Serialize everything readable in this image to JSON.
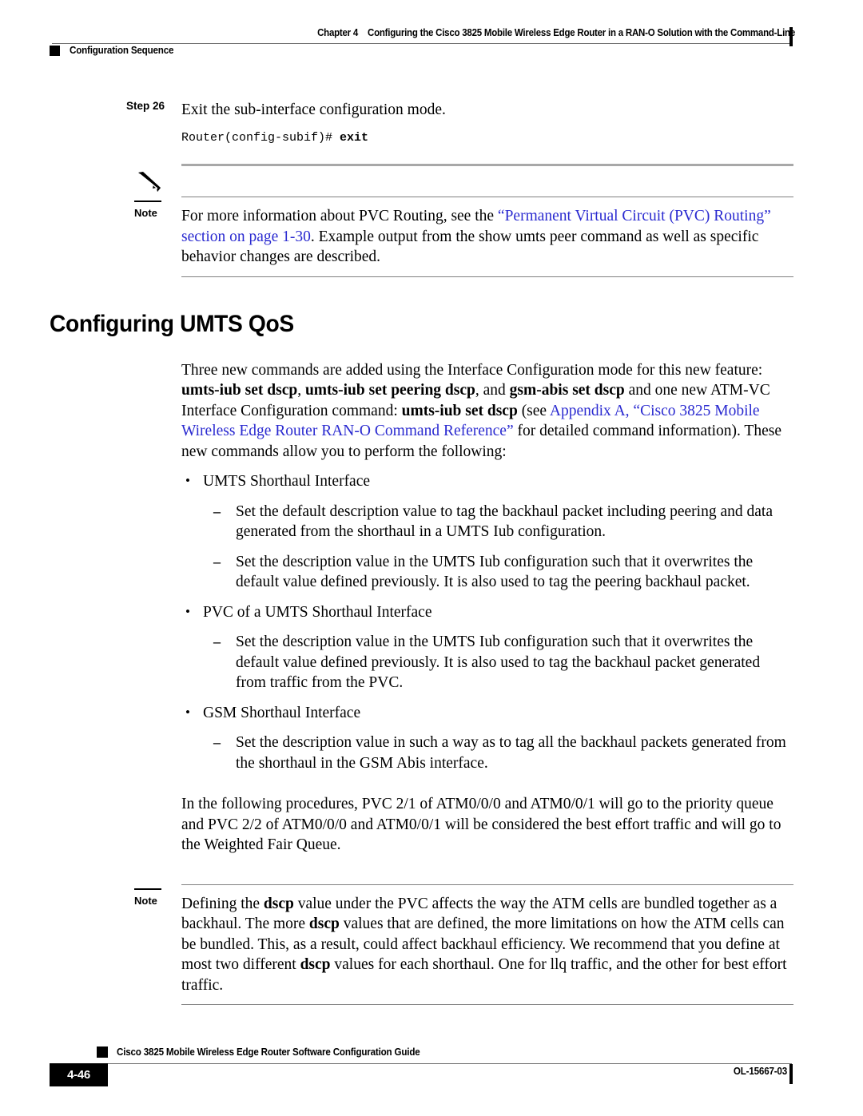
{
  "header": {
    "chapter_label": "Chapter 4",
    "chapter_title": "Configuring the Cisco 3825 Mobile Wireless Edge Router in a RAN-O Solution with the Command-Line",
    "section_name": "Configuration Sequence"
  },
  "step": {
    "label": "Step 26",
    "text": "Exit the sub-interface configuration mode.",
    "cli_prompt": "Router(config-subif)# ",
    "cli_command": "exit"
  },
  "note1": {
    "label": "Note",
    "icon": "pencil-icon",
    "text_part1": "For more information about PVC Routing, see the ",
    "link1": "“Permanent Virtual Circuit (PVC) Routing” section on page 1-30",
    "text_part2": ". Example output from the show umts peer command as well as specific behavior changes are described."
  },
  "section": {
    "title": "Configuring UMTS QoS"
  },
  "intro": {
    "t1": "Three new commands are added using the Interface Configuration mode for this new feature: ",
    "b1": "umts-iub set dscp",
    "t2": ", ",
    "b2": "umts-iub set peering dscp",
    "t3": ", and ",
    "b3": "gsm-abis set dscp",
    "t4": " and one new ATM-VC Interface Configuration command: ",
    "b4": "umts-iub set dscp",
    "t5": " (see ",
    "link": "Appendix A, “Cisco 3825 Mobile Wireless Edge Router RAN-O Command Reference”",
    "t6": " for detailed command information). These new commands allow you to perform the following:"
  },
  "bullets": [
    {
      "label": "UMTS Shorthaul Interface",
      "subs": [
        "Set the default description value to tag the backhaul packet including peering and data generated from the shorthaul in a UMTS Iub configuration.",
        "Set the description value in the UMTS Iub configuration such that it overwrites the default value defined previously. It is also used to tag the peering backhaul packet."
      ]
    },
    {
      "label": "PVC of a UMTS Shorthaul Interface",
      "subs": [
        "Set the description value in the UMTS Iub configuration such that it overwrites the default value defined previously. It is also used to tag the backhaul packet generated from traffic from the PVC."
      ]
    },
    {
      "label": "GSM Shorthaul Interface",
      "subs": [
        "Set the description value in such a way as to tag all the backhaul packets generated from the shorthaul in the GSM Abis interface."
      ]
    }
  ],
  "procedure_para": "In the following procedures, PVC 2/1 of ATM0/0/0 and ATM0/0/1 will go to the priority queue and PVC 2/2 of ATM0/0/0 and ATM0/0/1 will be considered the best effort traffic and will go to the Weighted Fair Queue.",
  "note2": {
    "label": "Note",
    "t1": "Defining the ",
    "b1": "dscp",
    "t2": " value under the PVC affects the way the ATM cells are bundled together as a backhaul. The more ",
    "b2": "dscp",
    "t3": " values that are defined, the more limitations on how the ATM cells can be bundled. This, as a result, could affect backhaul efficiency. We recommend that you define at most two different ",
    "b3": "dscp",
    "t4": " values for each shorthaul. One for llq traffic, and the other for best effort traffic."
  },
  "footer": {
    "guide_title": "Cisco 3825 Mobile Wireless Edge Router Software Configuration Guide",
    "page_number": "4-46",
    "doc_id": "OL-15667-03"
  },
  "colors": {
    "link": "#2a2ad0",
    "rule": "#808080",
    "marker": "#000000"
  }
}
